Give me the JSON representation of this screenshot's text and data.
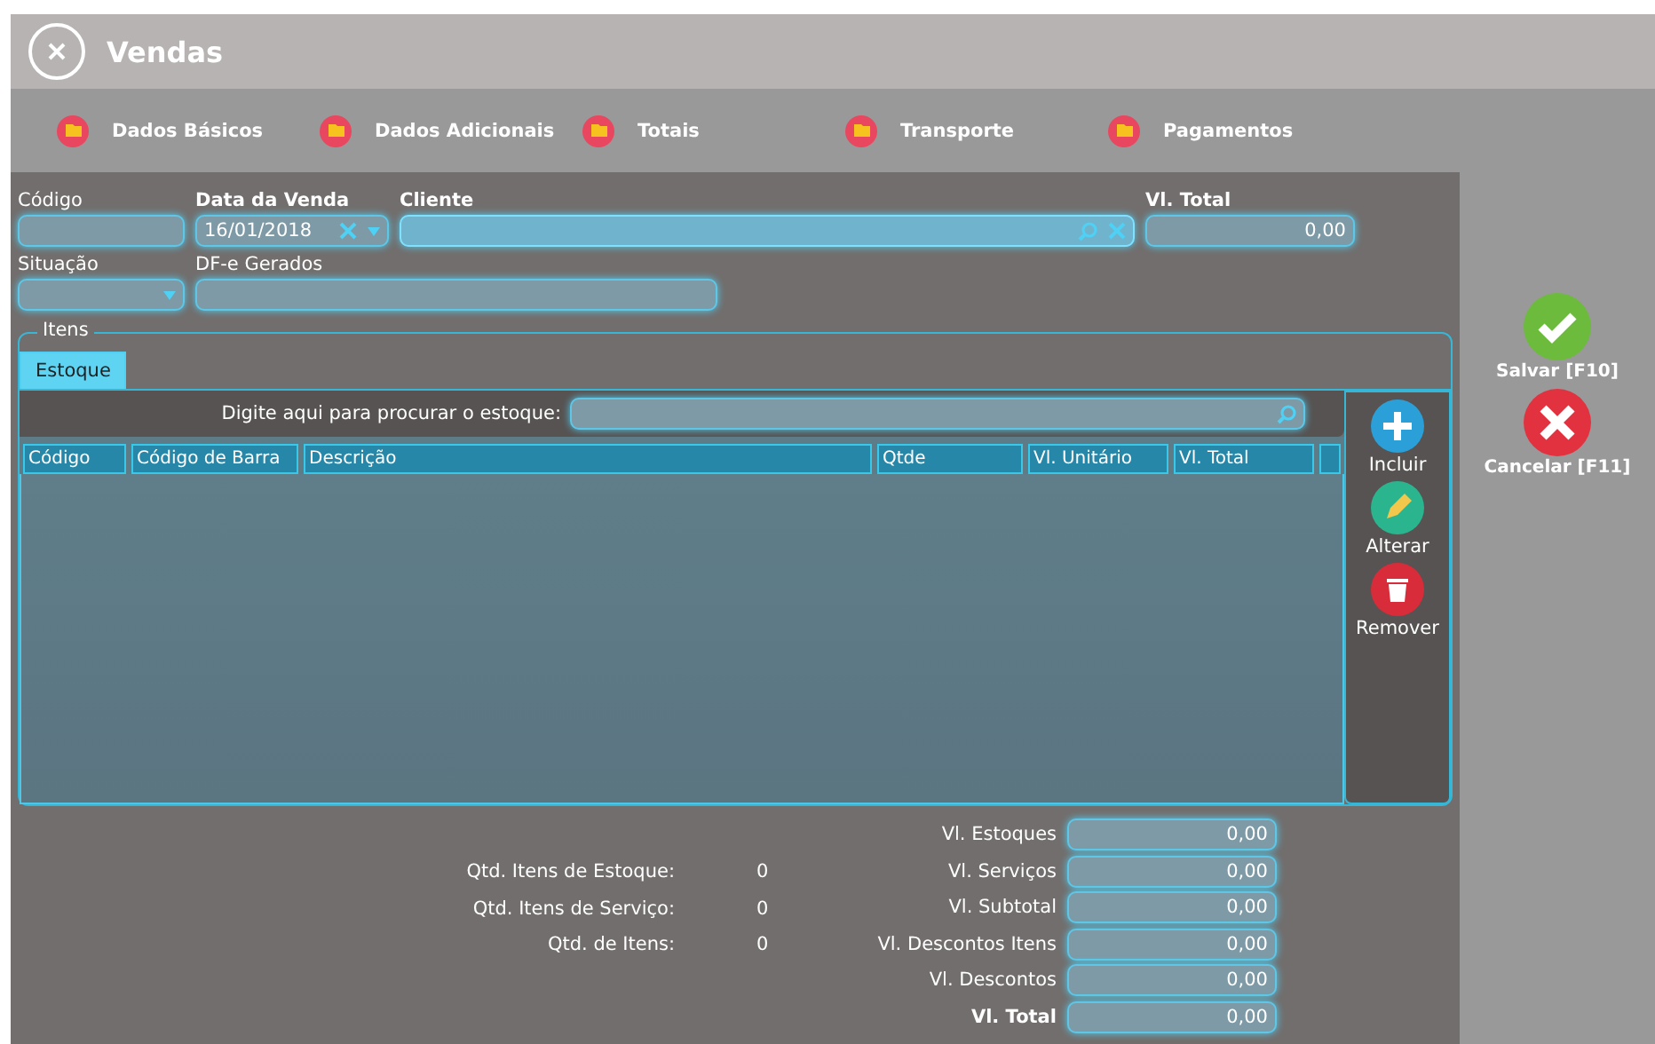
{
  "window": {
    "title": "Vendas"
  },
  "sections": [
    "Dados Básicos",
    "Dados Adicionais",
    "Totais",
    "Transporte",
    "Pagamentos"
  ],
  "form": {
    "codigo": {
      "label": "Código"
    },
    "data_venda": {
      "label": "Data da Venda",
      "value": "16/01/2018"
    },
    "cliente": {
      "label": "Cliente"
    },
    "vl_total": {
      "label": "Vl. Total",
      "value": "0,00"
    },
    "situacao": {
      "label": "Situação"
    },
    "dfe": {
      "label": "DF-e Gerados"
    }
  },
  "items": {
    "legend": "Itens",
    "tabs": [
      {
        "label": "Estoque",
        "selected": true
      }
    ],
    "search_label": "Digite aqui para procurar o estoque:",
    "columns": [
      "Código",
      "Código de Barra",
      "Descrição",
      "Qtde",
      "Vl. Unitário",
      "Vl. Total"
    ],
    "actions": [
      {
        "kind": "add",
        "label": "Incluir"
      },
      {
        "kind": "edit",
        "label": "Alterar"
      },
      {
        "kind": "remove",
        "label": "Remover"
      }
    ]
  },
  "counts": [
    {
      "label": "Qtd. Itens de Estoque:",
      "value": "0"
    },
    {
      "label": "Qtd. Itens de Serviço:",
      "value": "0"
    },
    {
      "label": "Qtd. de Itens:",
      "value": "0"
    }
  ],
  "totals": [
    {
      "label": "Vl. Estoques",
      "value": "0,00",
      "bold": false
    },
    {
      "label": "Vl. Serviços",
      "value": "0,00",
      "bold": false
    },
    {
      "label": "Vl. Subtotal",
      "value": "0,00",
      "bold": false
    },
    {
      "label": "Vl. Descontos Itens",
      "value": "0,00",
      "bold": false
    },
    {
      "label": "Vl. Descontos",
      "value": "0,00",
      "bold": false
    },
    {
      "label": "Vl. Total",
      "value": "0,00",
      "bold": true
    }
  ],
  "side_buttons": [
    {
      "kind": "save",
      "label": "Salvar [F10]"
    },
    {
      "kind": "cancel",
      "label": "Cancelar [F11]"
    }
  ]
}
